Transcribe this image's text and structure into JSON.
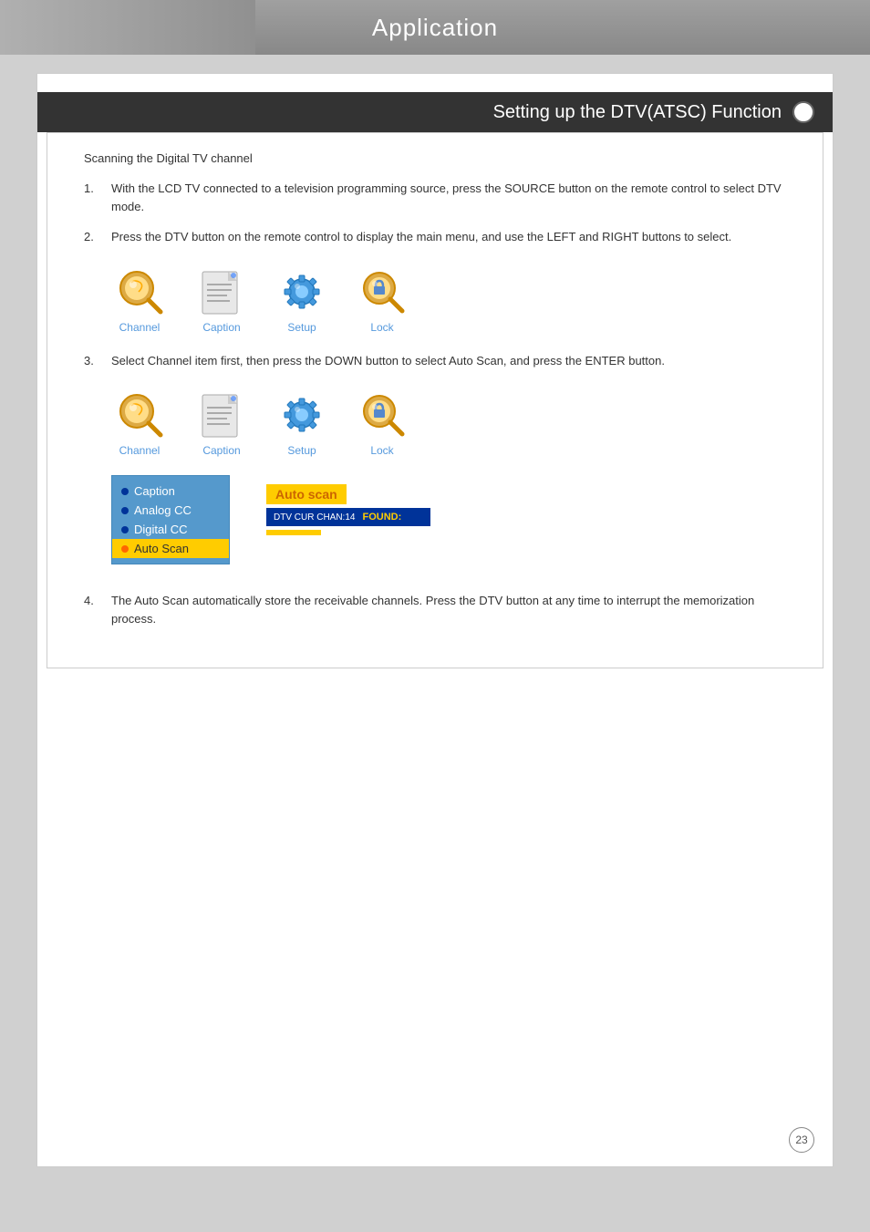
{
  "header": {
    "title": "Application"
  },
  "section": {
    "title": "Setting up the DTV(ATSC) Function"
  },
  "content": {
    "scanning_title": "Scanning the Digital TV channel",
    "steps": [
      {
        "number": "1.",
        "text": "With the LCD TV connected to a television programming source, press the SOURCE button on the remote control to select DTV mode."
      },
      {
        "number": "2.",
        "text": "Press the DTV button on the remote control to display the main menu, and use the LEFT and RIGHT buttons to select."
      },
      {
        "number": "3.",
        "text": "Select Channel item first, then press the DOWN button to select Auto Scan, and press the ENTER button."
      },
      {
        "number": "4.",
        "text": "The Auto Scan automatically store the receivable channels. Press the DTV button at any time to interrupt the memorization process."
      }
    ],
    "icons": [
      {
        "label": "Channel"
      },
      {
        "label": "Caption"
      },
      {
        "label": "Setup"
      },
      {
        "label": "Lock"
      }
    ],
    "menu_items": [
      {
        "label": "Caption",
        "bullet": "blue",
        "highlighted": false
      },
      {
        "label": "Analog CC",
        "bullet": "blue",
        "highlighted": false
      },
      {
        "label": "Digital CC",
        "bullet": "blue",
        "highlighted": false
      },
      {
        "label": "Auto Scan",
        "bullet": "orange",
        "highlighted": true
      }
    ],
    "auto_scan": {
      "title": "Auto scan",
      "channel_label": "DTV CUR CHAN:14",
      "found_label": "FOUND:"
    }
  },
  "page_number": "23"
}
